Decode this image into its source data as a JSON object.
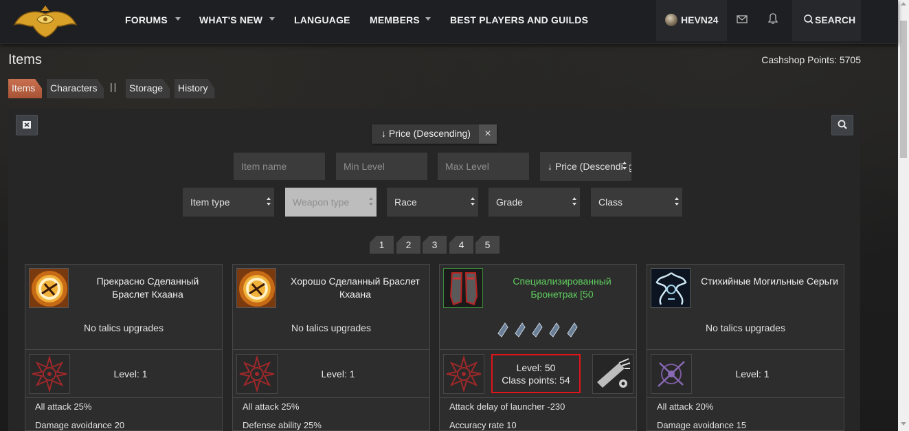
{
  "nav": {
    "items": [
      {
        "label": "FORUMS",
        "has_dropdown": true
      },
      {
        "label": "WHAT'S NEW",
        "has_dropdown": true
      },
      {
        "label": "LANGUAGE",
        "has_dropdown": false
      },
      {
        "label": "MEMBERS",
        "has_dropdown": true
      },
      {
        "label": "BEST PLAYERS AND GUILDS",
        "has_dropdown": false
      }
    ],
    "username": "HEVN24",
    "search_label": "SEARCH"
  },
  "page": {
    "title": "Items",
    "cashshop": "Cashshop Points: 5705"
  },
  "tabs": [
    {
      "label": "Items",
      "active": true
    },
    {
      "label": "Characters",
      "active": false
    },
    {
      "label": "Storage",
      "active": false
    },
    {
      "label": "History",
      "active": false
    }
  ],
  "tab_separator": "||",
  "filters": {
    "active_sort_chip": "↓ Price (Descending)",
    "chip_close": "×",
    "item_name_placeholder": "Item name",
    "min_level_placeholder": "Min Level",
    "max_level_placeholder": "Max Level",
    "sort_select": "↓ Price (Descending)",
    "item_type": "Item type",
    "weapon_type": "Weapon type",
    "race": "Race",
    "grade": "Grade",
    "class": "Class"
  },
  "pagination": [
    "1",
    "2",
    "3",
    "4",
    "5"
  ],
  "cards": [
    {
      "name": "Прекрасно Сделанный Браслет Кхаана",
      "talics": "No talics upgrades",
      "level": "Level: 1",
      "stats": [
        "All attack 25%",
        "Damage avoidance 20"
      ],
      "highlight_color": "#f0f0f0"
    },
    {
      "name": "Хорошо Сделанный Браслет Кхаана",
      "talics": "No talics upgrades",
      "level": "Level: 1",
      "stats": [
        "All attack 25%",
        "Defense ability 25%"
      ],
      "highlight_color": "#f0f0f0"
    },
    {
      "name": "Специализированный Бронетрак [50",
      "level": "Level: 50",
      "class_points": "Class points: 54",
      "stats": [
        "Attack delay of launcher -230",
        "Accuracy rate 10"
      ],
      "highlight_color": "#5fcf5f"
    },
    {
      "name": "Стихийные Могильные Серьги",
      "talics": "No talics upgrades",
      "level": "Level: 1",
      "stats": [
        "All attack 20%",
        "Damage avoidance 15"
      ],
      "highlight_color": "#f0f0f0"
    }
  ]
}
